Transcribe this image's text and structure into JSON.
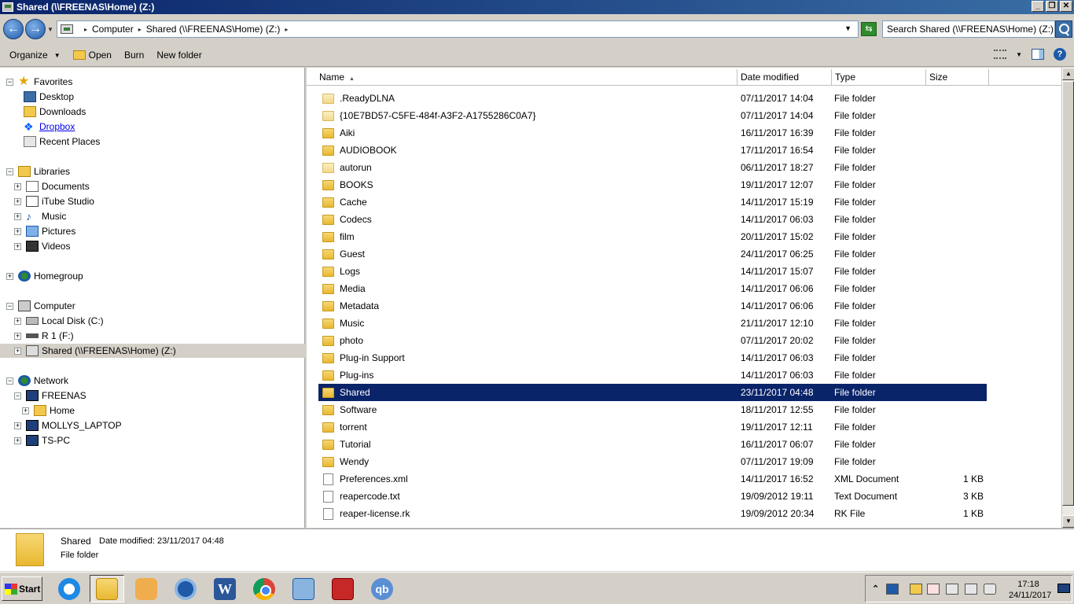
{
  "window": {
    "title": "Shared (\\\\FREENAS\\Home) (Z:)"
  },
  "address": {
    "crumbs": [
      "Computer",
      "Shared (\\\\FREENAS\\Home) (Z:)"
    ],
    "search_placeholder": "Search Shared (\\\\FREENAS\\Home) (Z:)"
  },
  "toolbar": {
    "organize": "Organize",
    "open": "Open",
    "burn": "Burn",
    "new_folder": "New folder"
  },
  "nav": {
    "favorites": {
      "label": "Favorites",
      "items": [
        "Desktop",
        "Downloads",
        "Dropbox",
        "Recent Places"
      ]
    },
    "libraries": {
      "label": "Libraries",
      "items": [
        "Documents",
        "iTube Studio",
        "Music",
        "Pictures",
        "Videos"
      ]
    },
    "homegroup": "Homegroup",
    "computer": {
      "label": "Computer",
      "items": [
        "Local Disk (C:)",
        "R 1 (F:)",
        "Shared (\\\\FREENAS\\Home) (Z:)"
      ]
    },
    "network": {
      "label": "Network",
      "freenas": "FREENAS",
      "home": "Home",
      "items": [
        "MOLLYS_LAPTOP",
        "TS-PC"
      ]
    }
  },
  "columns": {
    "name": "Name",
    "date": "Date modified",
    "type": "Type",
    "size": "Size"
  },
  "files": [
    {
      "name": ".ReadyDLNA",
      "date": "07/11/2017 14:04",
      "type": "File folder",
      "size": "",
      "kind": "folder-light"
    },
    {
      "name": "{10E7BD57-C5FE-484f-A3F2-A1755286C0A7}",
      "date": "07/11/2017 14:04",
      "type": "File folder",
      "size": "",
      "kind": "folder-light"
    },
    {
      "name": "Aiki",
      "date": "16/11/2017 16:39",
      "type": "File folder",
      "size": "",
      "kind": "folder"
    },
    {
      "name": "AUDIOBOOK",
      "date": "17/11/2017 16:54",
      "type": "File folder",
      "size": "",
      "kind": "folder"
    },
    {
      "name": "autorun",
      "date": "06/11/2017 18:27",
      "type": "File folder",
      "size": "",
      "kind": "folder-light"
    },
    {
      "name": "BOOKS",
      "date": "19/11/2017 12:07",
      "type": "File folder",
      "size": "",
      "kind": "folder"
    },
    {
      "name": "Cache",
      "date": "14/11/2017 15:19",
      "type": "File folder",
      "size": "",
      "kind": "folder"
    },
    {
      "name": "Codecs",
      "date": "14/11/2017 06:03",
      "type": "File folder",
      "size": "",
      "kind": "folder"
    },
    {
      "name": "film",
      "date": "20/11/2017 15:02",
      "type": "File folder",
      "size": "",
      "kind": "folder"
    },
    {
      "name": "Guest",
      "date": "24/11/2017 06:25",
      "type": "File folder",
      "size": "",
      "kind": "folder"
    },
    {
      "name": "Logs",
      "date": "14/11/2017 15:07",
      "type": "File folder",
      "size": "",
      "kind": "folder"
    },
    {
      "name": "Media",
      "date": "14/11/2017 06:06",
      "type": "File folder",
      "size": "",
      "kind": "folder"
    },
    {
      "name": "Metadata",
      "date": "14/11/2017 06:06",
      "type": "File folder",
      "size": "",
      "kind": "folder"
    },
    {
      "name": "Music",
      "date": "21/11/2017 12:10",
      "type": "File folder",
      "size": "",
      "kind": "folder"
    },
    {
      "name": "photo",
      "date": "07/11/2017 20:02",
      "type": "File folder",
      "size": "",
      "kind": "folder"
    },
    {
      "name": "Plug-in Support",
      "date": "14/11/2017 06:03",
      "type": "File folder",
      "size": "",
      "kind": "folder"
    },
    {
      "name": "Plug-ins",
      "date": "14/11/2017 06:03",
      "type": "File folder",
      "size": "",
      "kind": "folder"
    },
    {
      "name": "Shared",
      "date": "23/11/2017 04:48",
      "type": "File folder",
      "size": "",
      "kind": "folder",
      "selected": true
    },
    {
      "name": "Software",
      "date": "18/11/2017 12:55",
      "type": "File folder",
      "size": "",
      "kind": "folder"
    },
    {
      "name": "torrent",
      "date": "19/11/2017 12:11",
      "type": "File folder",
      "size": "",
      "kind": "folder"
    },
    {
      "name": "Tutorial",
      "date": "16/11/2017 06:07",
      "type": "File folder",
      "size": "",
      "kind": "folder"
    },
    {
      "name": "Wendy",
      "date": "07/11/2017 19:09",
      "type": "File folder",
      "size": "",
      "kind": "folder"
    },
    {
      "name": "Preferences.xml",
      "date": "14/11/2017 16:52",
      "type": "XML Document",
      "size": "1 KB",
      "kind": "file"
    },
    {
      "name": "reapercode.txt",
      "date": "19/09/2012 19:11",
      "type": "Text Document",
      "size": "3 KB",
      "kind": "file"
    },
    {
      "name": "reaper-license.rk",
      "date": "19/09/2012 20:34",
      "type": "RK File",
      "size": "1 KB",
      "kind": "file"
    }
  ],
  "details": {
    "name": "Shared",
    "modified": "Date modified: 23/11/2017 04:48",
    "type": "File folder"
  },
  "taskbar": {
    "start": "Start",
    "time": "17:18",
    "date": "24/11/2017"
  }
}
